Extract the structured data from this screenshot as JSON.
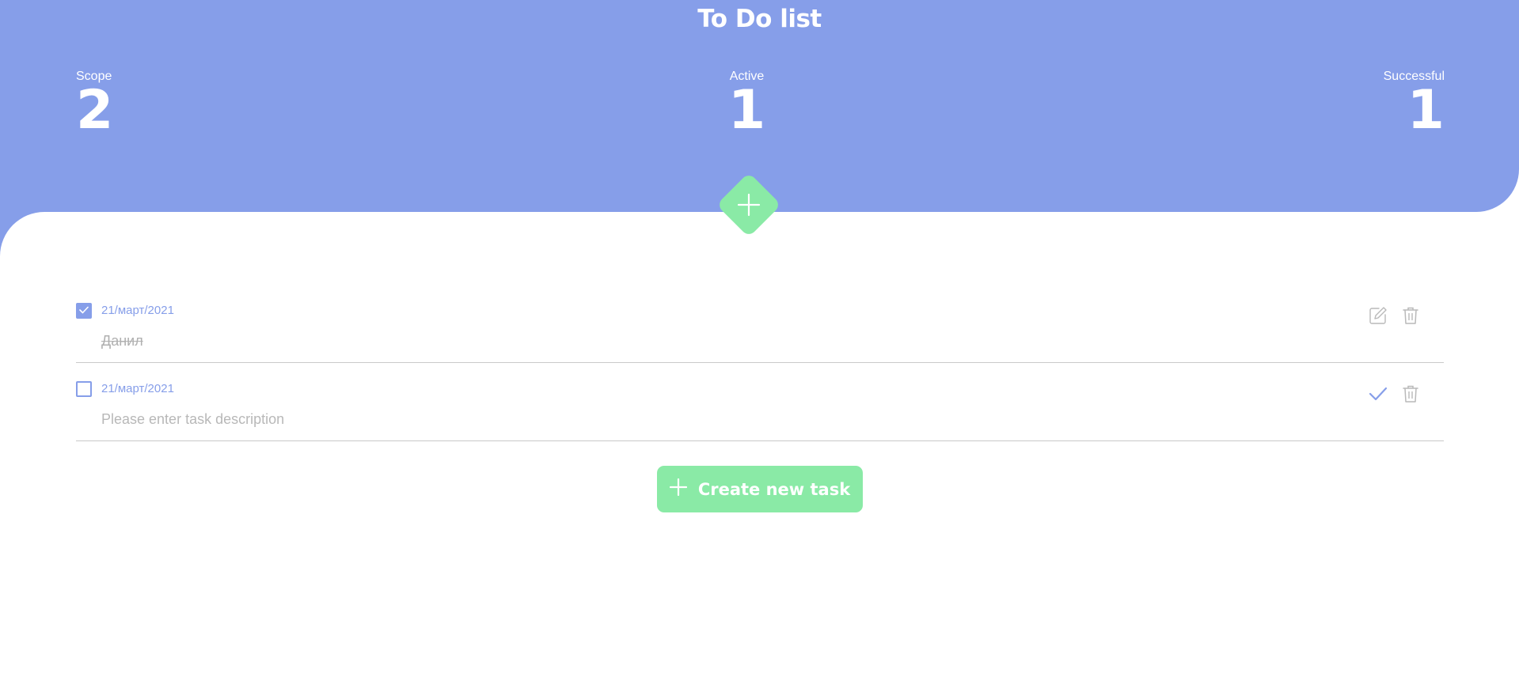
{
  "app": {
    "title": "To Do list"
  },
  "stats": {
    "scope": {
      "label": "Scope",
      "value": "2"
    },
    "active": {
      "label": "Active",
      "value": "1"
    },
    "successful": {
      "label": "Successful",
      "value": "1"
    }
  },
  "tasks": [
    {
      "date": "21/март/2021",
      "description": "Данил",
      "completed": true,
      "actions": [
        "pencil-icon",
        "trash-icon"
      ]
    },
    {
      "date": "21/март/2021",
      "description_placeholder": "Please enter task description",
      "completed": false,
      "actions": [
        "checkmark-icon",
        "trash-icon"
      ]
    }
  ],
  "create_button": {
    "label": "Create new task",
    "icon": "plus-icon"
  },
  "colors": {
    "header": "#869ee9",
    "accent_green": "#8aeaa6",
    "accent_blue": "#869ee9",
    "text_muted": "#b5b5b5"
  }
}
